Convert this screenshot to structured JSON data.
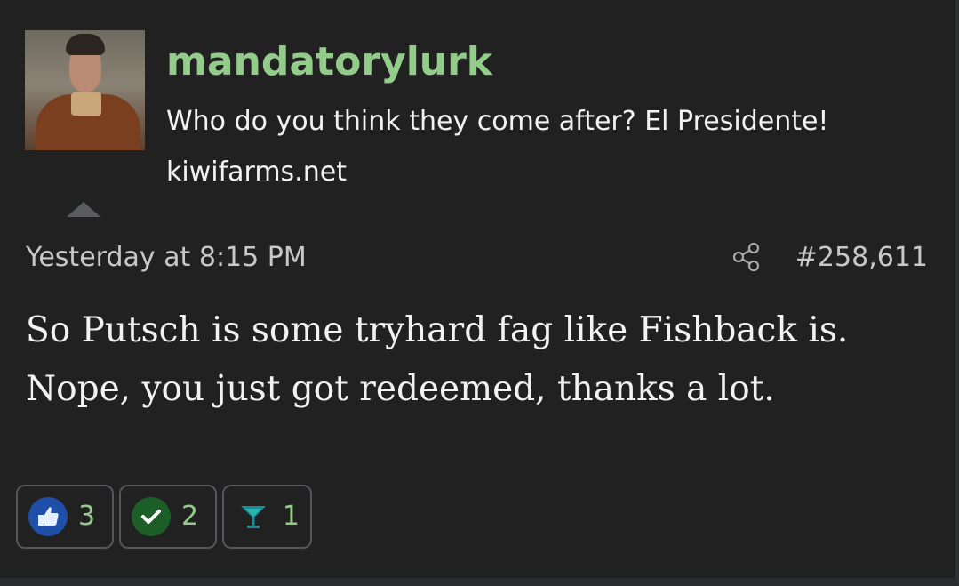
{
  "post": {
    "username": "mandatorylurk",
    "user_title": "Who do you think they come after? El Presidente!",
    "user_site": "kiwifarms.net",
    "timestamp": "Yesterday at 8:15 PM",
    "post_number": "#258,611",
    "body_lines": [
      "So Putsch is some tryhard fag like Fishback is.",
      "Nope, you just got redeemed, thanks a lot."
    ]
  },
  "reactions": [
    {
      "icon": "thumbs-up-icon",
      "count": "3",
      "color": "#1f4fa8"
    },
    {
      "icon": "checkmark-icon",
      "count": "2",
      "color": "#1c5e28"
    },
    {
      "icon": "martini-glass-icon",
      "count": "1",
      "color": "#1b8a9a"
    }
  ],
  "colors": {
    "username": "#93cc8a",
    "background": "#212121",
    "reaction_count": "#93cc8a"
  }
}
